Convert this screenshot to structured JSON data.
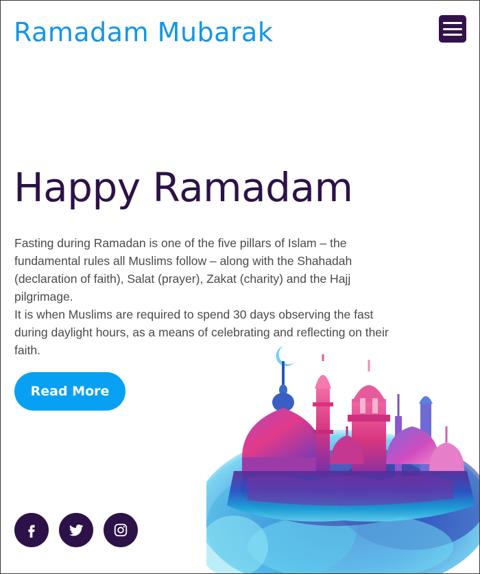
{
  "header": {
    "brand": "Ramadam Mubarak",
    "menu_icon": "hamburger-menu-icon"
  },
  "hero": {
    "title": "Happy Ramadam",
    "paragraphs": [
      "Fasting during Ramadan is one of the five pillars of Islam – the fundamental rules all Muslims follow – along with the Shahadah (declaration of faith), Salat (prayer), Zakat (charity) and the Hajj pilgrimage.",
      "It is when Muslims are required to spend 30 days observing the fast during daylight hours, as a means of celebrating and reflecting on their faith."
    ],
    "button_label": "Read More"
  },
  "social": [
    {
      "icon": "facebook-icon"
    },
    {
      "icon": "twitter-icon"
    },
    {
      "icon": "instagram-icon"
    }
  ],
  "colors": {
    "brand_blue": "#1196e8",
    "deep_purple": "#2d1249",
    "button_blue": "#08a0f2",
    "menu_bg": "#33124a"
  }
}
